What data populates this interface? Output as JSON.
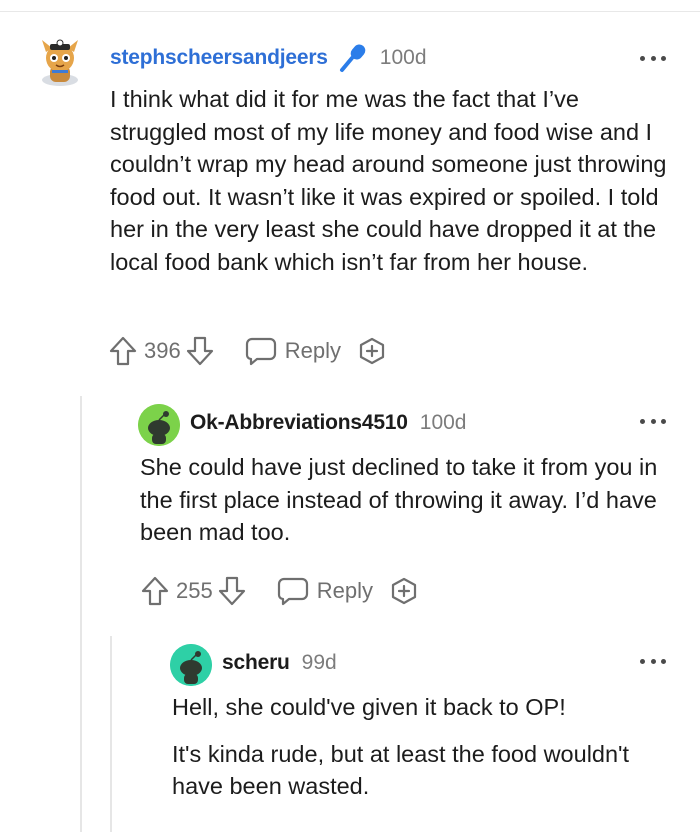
{
  "comments": [
    {
      "username": "stephscheersandjeers",
      "age": "100d",
      "body": "I think what did it for me was the fact that I’ve struggled most of my life money and food wise and I couldn’t wrap my head around someone just throwing food out. It wasn’t like it was expired or spoiled. I told her in the very least she could have dropped it at the local food bank which isn’t far from her house.",
      "votes": "396",
      "reply_label": "Reply",
      "icons": {
        "flair": "microphone-icon",
        "upvote": "arrow-up-icon",
        "downvote": "arrow-down-icon",
        "reply": "speech-bubble-icon",
        "award": "award-plus-icon",
        "more": "more-dots-icon"
      }
    },
    {
      "username": "Ok-Abbreviations4510",
      "age": "100d",
      "body": "She could have just declined to take it from you in the first place instead of throwing it away. I’d have been mad too.",
      "votes": "255",
      "reply_label": "Reply"
    },
    {
      "username": "scheru",
      "age": "99d",
      "paragraphs": [
        "Hell, she could've given it back to OP!",
        "It's kinda rude, but at least the food wouldn't have been wasted."
      ]
    }
  ],
  "colors": {
    "username_link": "#2e6fd6",
    "mic": "#2b7de9",
    "avatar_green": "#7cd24a",
    "avatar_teal": "#2ed0a6",
    "muted": "#7c7c7c"
  }
}
